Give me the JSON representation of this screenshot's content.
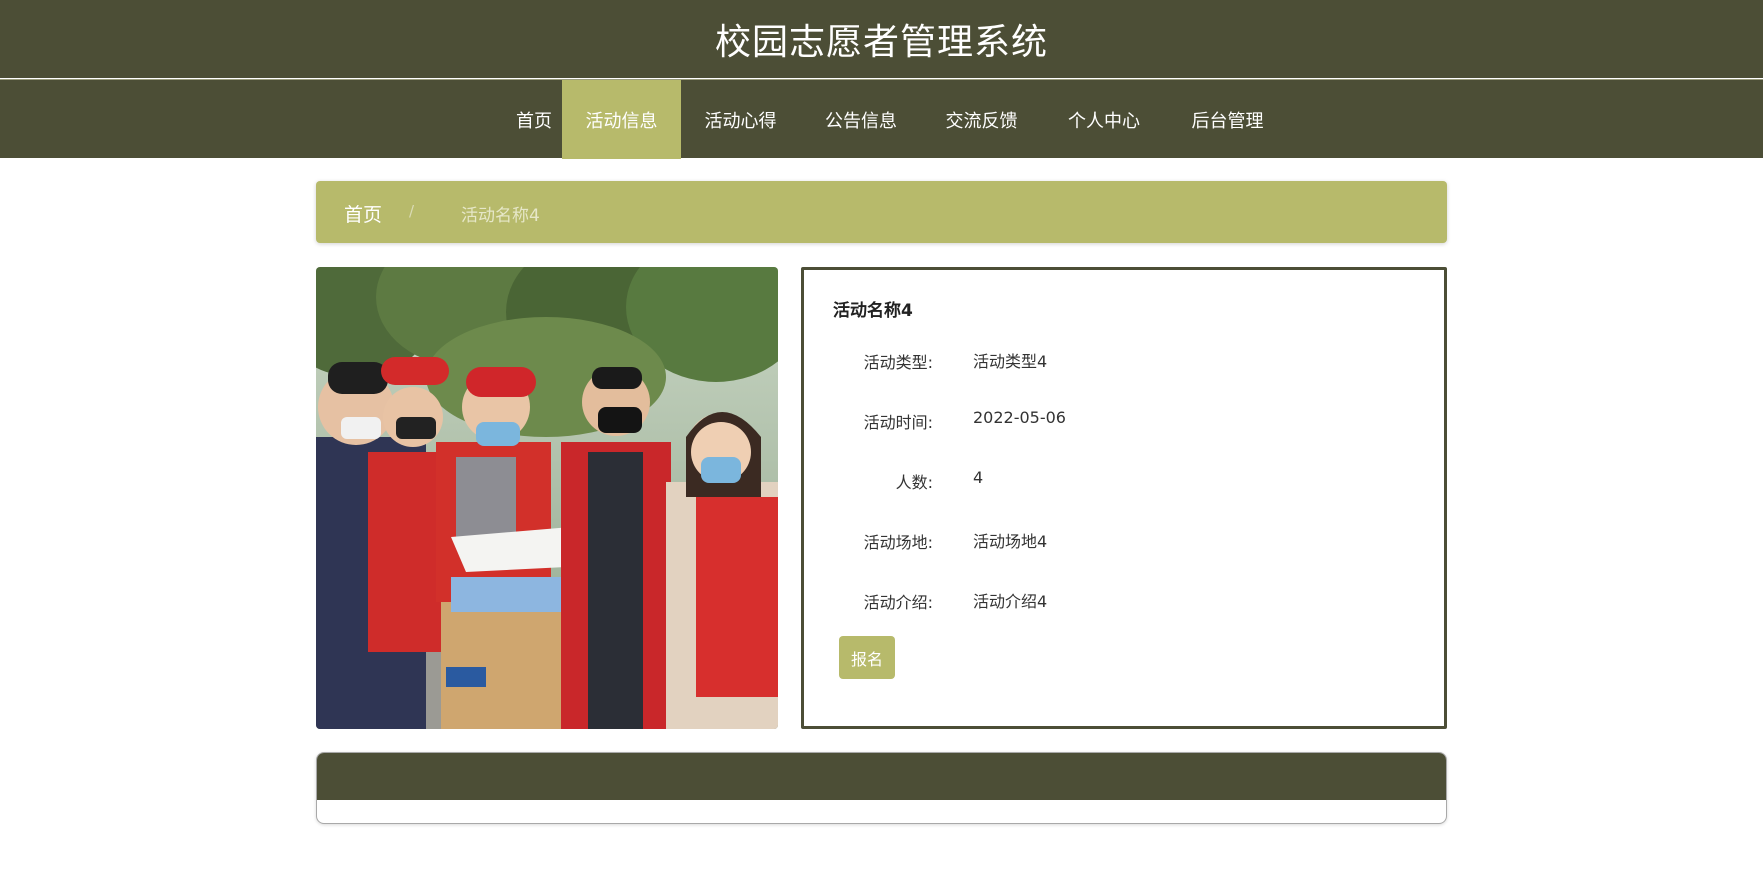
{
  "app": {
    "title": "校园志愿者管理系统"
  },
  "nav": {
    "items": [
      {
        "label": "首页"
      },
      {
        "label": "活动信息"
      },
      {
        "label": "活动心得"
      },
      {
        "label": "公告信息"
      },
      {
        "label": "交流反馈"
      },
      {
        "label": "个人中心"
      },
      {
        "label": "后台管理"
      }
    ],
    "active_index": 1
  },
  "breadcrumb": {
    "home": "首页",
    "separator": "/",
    "current": "活动名称4"
  },
  "activity": {
    "name": "活动名称4",
    "fields": [
      {
        "label": "活动类型:",
        "value": "活动类型4"
      },
      {
        "label": "活动时间:",
        "value": "2022-05-06"
      },
      {
        "label": "人数:",
        "value": "4"
      },
      {
        "label": "活动场地:",
        "value": "活动场地4"
      },
      {
        "label": "活动介绍:",
        "value": "活动介绍4"
      }
    ],
    "signup_label": "报名",
    "image": "volunteers-photo"
  },
  "colors": {
    "header_bg": "#4c4e36",
    "accent": "#b7ba6b",
    "text": "#333333"
  }
}
